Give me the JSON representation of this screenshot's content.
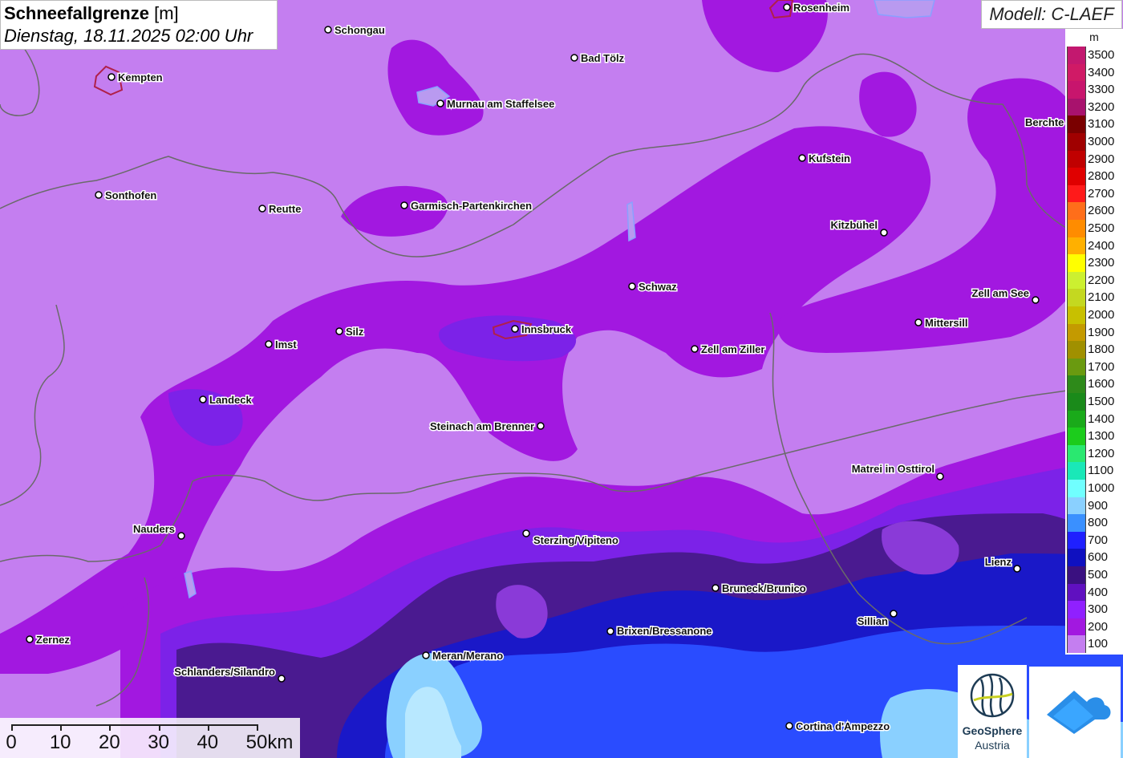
{
  "title": {
    "main": "Schneefallgrenze",
    "unit": "[m]",
    "datetime": "Dienstag, 18.11.2025 02:00 Uhr"
  },
  "model_label": "Modell: C-LAEF",
  "legend": {
    "unit": "m",
    "levels": [
      {
        "value": "3500",
        "color": "#c3186f"
      },
      {
        "value": "3400",
        "color": "#d01a66"
      },
      {
        "value": "3300",
        "color": "#c8156d"
      },
      {
        "value": "3200",
        "color": "#a8126d"
      },
      {
        "value": "3100",
        "color": "#7a0000"
      },
      {
        "value": "3000",
        "color": "#a00000"
      },
      {
        "value": "2900",
        "color": "#c00000"
      },
      {
        "value": "2800",
        "color": "#e00000"
      },
      {
        "value": "2700",
        "color": "#ff1a1a"
      },
      {
        "value": "2600",
        "color": "#ff6e1a"
      },
      {
        "value": "2500",
        "color": "#ff8c00"
      },
      {
        "value": "2400",
        "color": "#ffb000"
      },
      {
        "value": "2300",
        "color": "#ffff00"
      },
      {
        "value": "2200",
        "color": "#ccf030"
      },
      {
        "value": "2100",
        "color": "#c4d820"
      },
      {
        "value": "2000",
        "color": "#c8c000"
      },
      {
        "value": "1900",
        "color": "#c49a00"
      },
      {
        "value": "1800",
        "color": "#a09000"
      },
      {
        "value": "1700",
        "color": "#6a9a10"
      },
      {
        "value": "1600",
        "color": "#2e8a1a"
      },
      {
        "value": "1500",
        "color": "#1a8a1a"
      },
      {
        "value": "1400",
        "color": "#1aaa1a"
      },
      {
        "value": "1300",
        "color": "#1ccc1c"
      },
      {
        "value": "1200",
        "color": "#2ae870"
      },
      {
        "value": "1100",
        "color": "#1ae8b8"
      },
      {
        "value": "1000",
        "color": "#70ffff"
      },
      {
        "value": "900",
        "color": "#8ad0ff"
      },
      {
        "value": "800",
        "color": "#3a90ff"
      },
      {
        "value": "700",
        "color": "#1f20ff"
      },
      {
        "value": "600",
        "color": "#0f10c0"
      },
      {
        "value": "500",
        "color": "#3a1080"
      },
      {
        "value": "400",
        "color": "#6010c0"
      },
      {
        "value": "300",
        "color": "#9020ff"
      },
      {
        "value": "200",
        "color": "#a218e0"
      },
      {
        "value": "100",
        "color": "#c47ef0"
      }
    ]
  },
  "scale_bar": {
    "labels": [
      "0",
      "10",
      "20",
      "30",
      "40",
      "50km"
    ]
  },
  "cities": [
    {
      "name": "Rosenheim"
    },
    {
      "name": "Schongau"
    },
    {
      "name": "Kempten"
    },
    {
      "name": "Bad Tölz"
    },
    {
      "name": "Murnau am Staffelsee"
    },
    {
      "name": "Kufstein"
    },
    {
      "name": "Sonthofen"
    },
    {
      "name": "Reutte"
    },
    {
      "name": "Garmisch-Partenkirchen"
    },
    {
      "name": "Kitzbühel"
    },
    {
      "name": "Schwaz"
    },
    {
      "name": "Zell am See"
    },
    {
      "name": "Imst"
    },
    {
      "name": "Silz"
    },
    {
      "name": "Innsbruck"
    },
    {
      "name": "Mittersill"
    },
    {
      "name": "Zell am Ziller"
    },
    {
      "name": "Landeck"
    },
    {
      "name": "Steinach am Brenner"
    },
    {
      "name": "Matrei in Osttirol"
    },
    {
      "name": "Nauders"
    },
    {
      "name": "Sterzing/Vipiteno"
    },
    {
      "name": "Lienz"
    },
    {
      "name": "Bruneck/Brunico"
    },
    {
      "name": "Sillian"
    },
    {
      "name": "Brixen/Bressanone"
    },
    {
      "name": "Zernez"
    },
    {
      "name": "Meran/Merano"
    },
    {
      "name": "Schlanders/Silandro"
    },
    {
      "name": "Cortina d'Ampezzo"
    },
    {
      "name": "Berchte"
    }
  ],
  "logos": {
    "geosphere_line1": "GeoSphere",
    "geosphere_line2": "Austria"
  }
}
